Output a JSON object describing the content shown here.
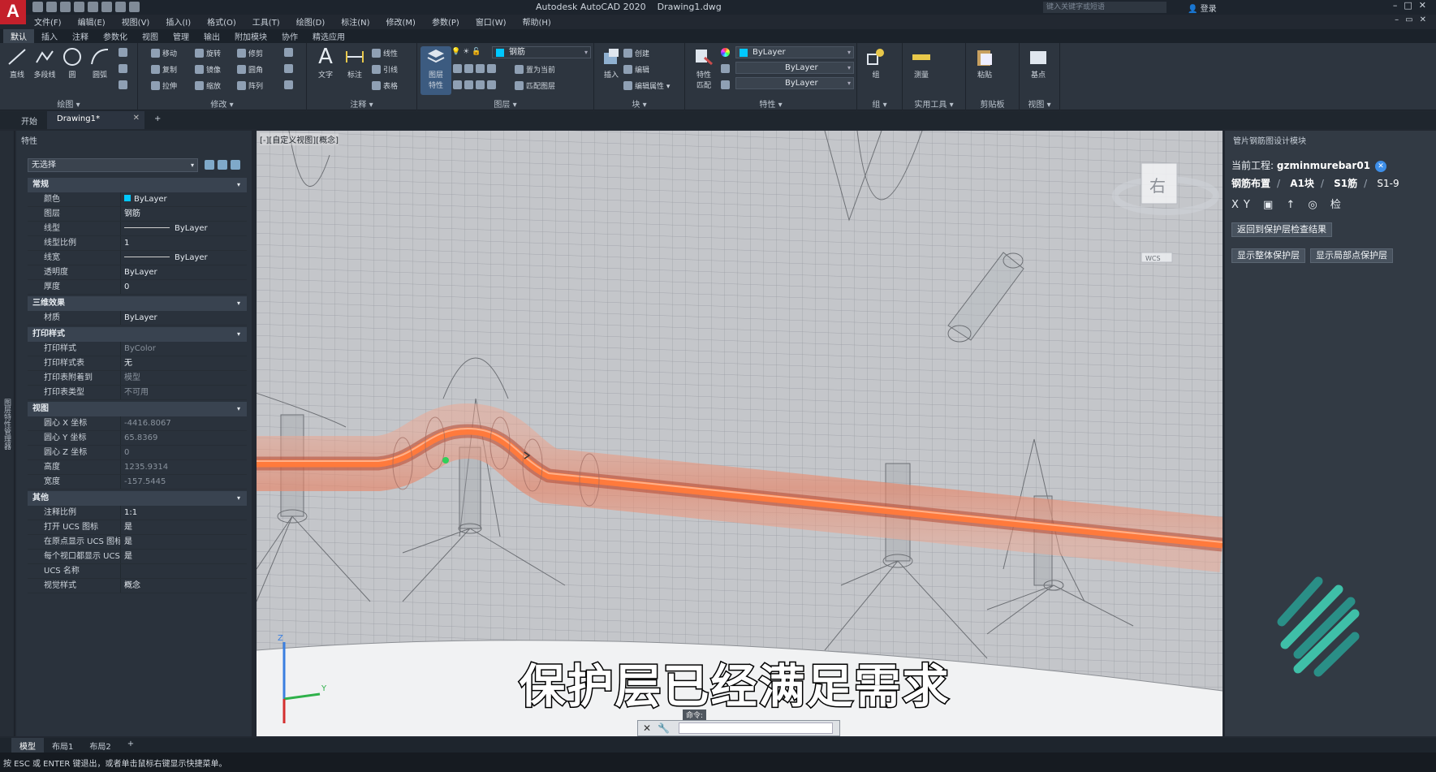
{
  "app": {
    "title": "Autodesk AutoCAD 2020",
    "document": "Drawing1.dwg",
    "logo": "A",
    "search_placeholder": "键入关键字或短语",
    "login": "登录"
  },
  "menu": [
    "文件(F)",
    "编辑(E)",
    "视图(V)",
    "插入(I)",
    "格式(O)",
    "工具(T)",
    "绘图(D)",
    "标注(N)",
    "修改(M)",
    "参数(P)",
    "窗口(W)",
    "帮助(H)"
  ],
  "ribbon_tabs": [
    "默认",
    "插入",
    "注释",
    "参数化",
    "视图",
    "管理",
    "输出",
    "附加模块",
    "协作",
    "精选应用"
  ],
  "ribbon": {
    "draw": {
      "label": "绘图",
      "buttons": [
        "直线",
        "多段线",
        "圆",
        "圆弧"
      ]
    },
    "modify": {
      "label": "修改",
      "buttons": [
        "移动",
        "旋转",
        "修剪",
        "复制",
        "镜像",
        "圆角",
        "拉伸",
        "缩放",
        "阵列"
      ]
    },
    "annotate": {
      "label": "注释",
      "buttons": [
        "文字",
        "标注",
        "线性",
        "引线",
        "表格"
      ]
    },
    "layers": {
      "label": "图层",
      "big": "图层\n特性",
      "layer_name": "钢筋",
      "buttons": [
        "置为当前",
        "匹配图层"
      ]
    },
    "block": {
      "label": "块",
      "buttons": [
        "插入",
        "创建",
        "编辑",
        "编辑属性"
      ]
    },
    "properties": {
      "label": "特性",
      "big": "特性\n匹配",
      "color": "ByLayer",
      "linetype": "ByLayer",
      "lineweight": "ByLayer"
    },
    "groups": {
      "label": "组",
      "big": "组"
    },
    "utilities": {
      "label": "实用工具",
      "big": "测量"
    },
    "clipboard": {
      "label": "剪贴板",
      "big": "粘贴"
    },
    "view": {
      "label": "视图",
      "big": "基点"
    }
  },
  "doc_tabs": [
    "开始",
    "Drawing1*"
  ],
  "side_strip_label": "图层特性管理器",
  "properties": {
    "title": "特性",
    "selection": "无选择",
    "sections": [
      {
        "name": "常规",
        "rows": [
          [
            "颜色",
            "ByLayer"
          ],
          [
            "图层",
            "钢筋"
          ],
          [
            "线型",
            "ByLayer"
          ],
          [
            "线型比例",
            "1"
          ],
          [
            "线宽",
            "ByLayer"
          ],
          [
            "透明度",
            "ByLayer"
          ],
          [
            "厚度",
            "0"
          ]
        ]
      },
      {
        "name": "三维效果",
        "rows": [
          [
            "材质",
            "ByLayer"
          ]
        ]
      },
      {
        "name": "打印样式",
        "rows": [
          [
            "打印样式",
            "ByColor"
          ],
          [
            "打印样式表",
            "无"
          ],
          [
            "打印表附着到",
            "模型"
          ],
          [
            "打印表类型",
            "不可用"
          ]
        ]
      },
      {
        "name": "视图",
        "rows": [
          [
            "圆心 X 坐标",
            "-4416.8067"
          ],
          [
            "圆心 Y 坐标",
            "65.8369"
          ],
          [
            "圆心 Z 坐标",
            "0"
          ],
          [
            "高度",
            "1235.9314"
          ],
          [
            "宽度",
            "-157.5445"
          ]
        ]
      },
      {
        "name": "其他",
        "rows": [
          [
            "注释比例",
            "1:1"
          ],
          [
            "打开 UCS 图标",
            "是"
          ],
          [
            "在原点显示 UCS 图标",
            "是"
          ],
          [
            "每个视口都显示 UCS",
            "是"
          ],
          [
            "UCS 名称",
            ""
          ],
          [
            "视觉样式",
            "概念"
          ]
        ]
      }
    ]
  },
  "viewport": {
    "label": "[-][自定义视图][概念]",
    "viewcube_face": "右",
    "wcs": "WCS",
    "subtitle": "保护层已经满足需求",
    "command_label": "命令:"
  },
  "right_panel": {
    "title": "管片钢筋图设计模块",
    "project_label": "当前工程:",
    "project_name": "gzminmurebar01",
    "crumbs": [
      "钢筋布置",
      "A1块",
      "S1筋",
      "S1-9"
    ],
    "tools": "XY ▣ ↑ ◎ 检",
    "btn_return": "返回到保护层检查结果",
    "btn_overall": "显示整体保护层",
    "btn_local": "显示局部点保护层"
  },
  "layout_tabs": [
    "模型",
    "布局1",
    "布局2"
  ],
  "status": "按 ESC 或 ENTER 键退出，或者单击鼠标右键显示快捷菜单。",
  "colors": {
    "accent": "#c4202b",
    "layer": "#00c8ff",
    "pipe": "#ff7a3c"
  }
}
